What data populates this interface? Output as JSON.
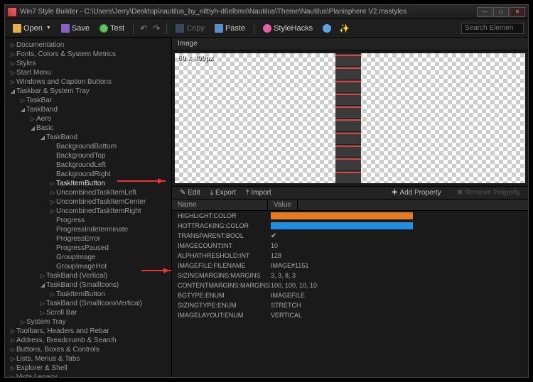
{
  "title": "Win7 Style Builder - C:\\Users\\Jerry\\Desktop\\nautilus_by_nittiyh-d6elbms\\Nautilus\\Theme\\Nautilus\\Planisphere V2.msstyles",
  "toolbar": {
    "open": "Open",
    "save": "Save",
    "test": "Test",
    "copy": "Copy",
    "paste": "Paste",
    "stylehacks": "StyleHacks"
  },
  "search_placeholder": "Search Elemen",
  "imagepanel": {
    "title": "Image",
    "dims": "60 x 400px"
  },
  "propbar": {
    "edit": "Edit",
    "export": "Export",
    "import": "Import",
    "add": "Add Property",
    "remove": "Remove Property"
  },
  "columns": {
    "name": "Name",
    "value": "Value"
  },
  "tree": [
    {
      "d": 0,
      "t": "r",
      "l": "Documentation"
    },
    {
      "d": 0,
      "t": "r",
      "l": "Fonts, Colors & System Metrics"
    },
    {
      "d": 0,
      "t": "r",
      "l": "Styles"
    },
    {
      "d": 0,
      "t": "r",
      "l": "Start Menu"
    },
    {
      "d": 0,
      "t": "r",
      "l": "Windows and Caption Buttons"
    },
    {
      "d": 0,
      "t": "d",
      "l": "Taskbar & System Tray"
    },
    {
      "d": 1,
      "t": "r",
      "l": "TaskBar"
    },
    {
      "d": 1,
      "t": "d",
      "l": "TaskBand"
    },
    {
      "d": 2,
      "t": "r",
      "l": "Aero"
    },
    {
      "d": 2,
      "t": "d",
      "l": "Basic"
    },
    {
      "d": 3,
      "t": "d",
      "l": "TaskBand"
    },
    {
      "d": 4,
      "t": "n",
      "l": "BackgroundBottom"
    },
    {
      "d": 4,
      "t": "n",
      "l": "BackgroundTop"
    },
    {
      "d": 4,
      "t": "n",
      "l": "BackgroundLeft"
    },
    {
      "d": 4,
      "t": "n",
      "l": "BackgroundRight"
    },
    {
      "d": 4,
      "t": "r",
      "l": "TaskItemButton",
      "sel": true
    },
    {
      "d": 4,
      "t": "r",
      "l": "UncombinedTaskItemLeft"
    },
    {
      "d": 4,
      "t": "r",
      "l": "UncombinedTaskItemCenter"
    },
    {
      "d": 4,
      "t": "r",
      "l": "UncombinedTaskItemRight"
    },
    {
      "d": 4,
      "t": "n",
      "l": "Progress"
    },
    {
      "d": 4,
      "t": "n",
      "l": "ProgressIndeterminate"
    },
    {
      "d": 4,
      "t": "n",
      "l": "ProgressError"
    },
    {
      "d": 4,
      "t": "n",
      "l": "ProgressPaused"
    },
    {
      "d": 4,
      "t": "n",
      "l": "GroupImage"
    },
    {
      "d": 4,
      "t": "n",
      "l": "GroupImageHot"
    },
    {
      "d": 3,
      "t": "r",
      "l": "TaskBand (Vertical)"
    },
    {
      "d": 3,
      "t": "d",
      "l": "TaskBand (SmallIcons)"
    },
    {
      "d": 4,
      "t": "r",
      "l": "TaskItemButton"
    },
    {
      "d": 3,
      "t": "r",
      "l": "TaskBand (SmallIconsVertical)"
    },
    {
      "d": 3,
      "t": "r",
      "l": "Scroll Bar"
    },
    {
      "d": 1,
      "t": "r",
      "l": "System Tray"
    },
    {
      "d": 0,
      "t": "r",
      "l": "Toolbars, Headers and Rebar"
    },
    {
      "d": 0,
      "t": "r",
      "l": "Address, Breadcrumb & Search"
    },
    {
      "d": 0,
      "t": "r",
      "l": "Buttons, Boxes & Controls"
    },
    {
      "d": 0,
      "t": "r",
      "l": "Lists, Menus & Tabs"
    },
    {
      "d": 0,
      "t": "r",
      "l": "Explorer & Shell"
    },
    {
      "d": 0,
      "t": "r",
      "l": "Vista Legacy"
    }
  ],
  "props": [
    {
      "n": "HIGHLIGHT:COLOR",
      "v": "",
      "c": "#e67a1f"
    },
    {
      "n": "HOTTRACKING:COLOR",
      "v": "",
      "c": "#1f8fe6"
    },
    {
      "n": "TRANSPARENT:BOOL",
      "v": "✓",
      "tick": true
    },
    {
      "n": "IMAGECOUNT:INT",
      "v": "10"
    },
    {
      "n": "ALPHATHRESHOLD:INT",
      "v": "128"
    },
    {
      "n": "IMAGEFILE:FILENAME",
      "v": "IMAGE#1151"
    },
    {
      "n": "SIZINGMARGINS:MARGINS",
      "v": "3, 3, 8, 3"
    },
    {
      "n": "CONTENTMARGINS:MARGINS",
      "v": "100, 100, 10, 10"
    },
    {
      "n": "BGTYPE:ENUM",
      "v": "IMAGEFILE"
    },
    {
      "n": "SIZINGTYPE:ENUM",
      "v": "STRETCH"
    },
    {
      "n": "IMAGELAYOUT:ENUM",
      "v": "VERTICAL"
    }
  ]
}
